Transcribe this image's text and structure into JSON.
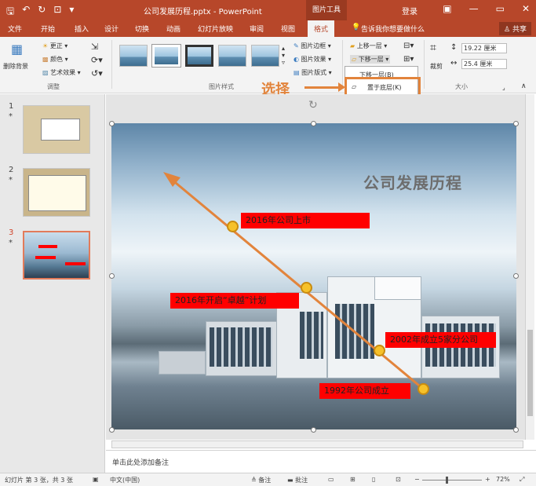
{
  "titlebar": {
    "title": "公司发展历程.pptx - PowerPoint",
    "context_tab": "图片工具",
    "login": "登录",
    "minimize": "—",
    "restore": "▭",
    "close": "✕"
  },
  "tabs": [
    "文件",
    "开始",
    "插入",
    "设计",
    "切换",
    "动画",
    "幻灯片放映",
    "审阅",
    "视图",
    "格式"
  ],
  "tell_me": "告诉我你想要做什么",
  "share": "共享",
  "ribbon": {
    "remove_bg": "删除背景",
    "corrections": "更正",
    "color": "颜色",
    "artistic": "艺术效果",
    "adjust_group": "调整",
    "styles_group": "图片样式",
    "border": "图片边框",
    "effects": "图片效果",
    "layout": "图片版式",
    "bring_forward": "上移一层",
    "send_backward": "下移一层",
    "crop": "裁剪",
    "height": "19.22 厘米",
    "width": "25.4 厘米",
    "size_group": "大小",
    "dropdown_items": [
      "下移一层(B)",
      "置于底层(K)"
    ]
  },
  "annotation": {
    "choose": "选择"
  },
  "slides_panel": {
    "numbers": [
      "1",
      "2",
      "3"
    ],
    "star": "*"
  },
  "slide": {
    "title": "公司发展历程",
    "labels": [
      "2016年公司上市",
      "2016年开启“卓越”计划",
      "2002年成立5家分公司",
      "1992年公司成立"
    ],
    "accent_color": "#e2843c",
    "label_color": "#ff0000",
    "dot_color": "#f6c12a"
  },
  "notes": {
    "placeholder": "单击此处添加备注"
  },
  "status": {
    "slide_info": "幻灯片 第 3 张，共 3 张",
    "language": "中文(中国)",
    "notes_btn": "备注",
    "comments_btn": "批注",
    "zoom": "72%"
  }
}
